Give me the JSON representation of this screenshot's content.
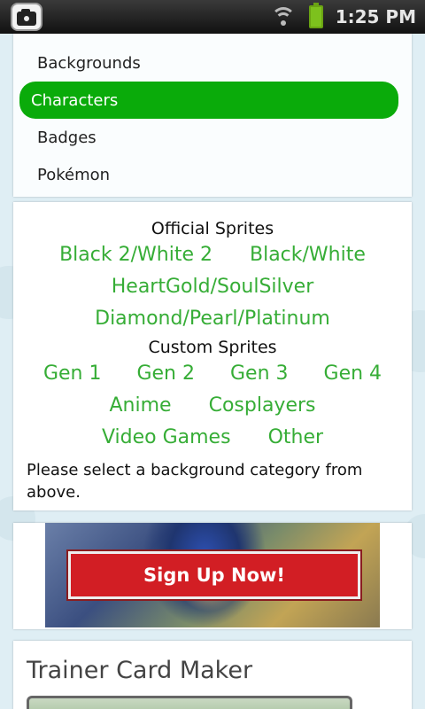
{
  "status_bar": {
    "time": "1:25 PM",
    "notification_icon": "camera-icon",
    "wifi_icon": "wifi-icon",
    "battery_icon": "battery-icon",
    "battery_color": "#7dc11d"
  },
  "nav": {
    "items": [
      {
        "label": "Backgrounds"
      },
      {
        "label": "Characters"
      },
      {
        "label": "Badges"
      },
      {
        "label": "Pokémon"
      }
    ],
    "active_index": 1,
    "active_color": "#0aab0a"
  },
  "sprites": {
    "official_title": "Official Sprites",
    "official_links": [
      "Black 2/White 2",
      "Black/White",
      "HeartGold/SoulSilver",
      "Diamond/Pearl/Platinum"
    ],
    "custom_title": "Custom Sprites",
    "custom_links": [
      "Gen 1",
      "Gen 2",
      "Gen 3",
      "Gen 4",
      "Anime",
      "Cosplayers",
      "Video Games",
      "Other"
    ],
    "link_color": "#36ad36",
    "helper_text": "Please select a background category from above."
  },
  "ad": {
    "button_label": "Sign Up Now!",
    "button_color": "#d21e24"
  },
  "trainer_card": {
    "title": "Trainer Card Maker"
  }
}
